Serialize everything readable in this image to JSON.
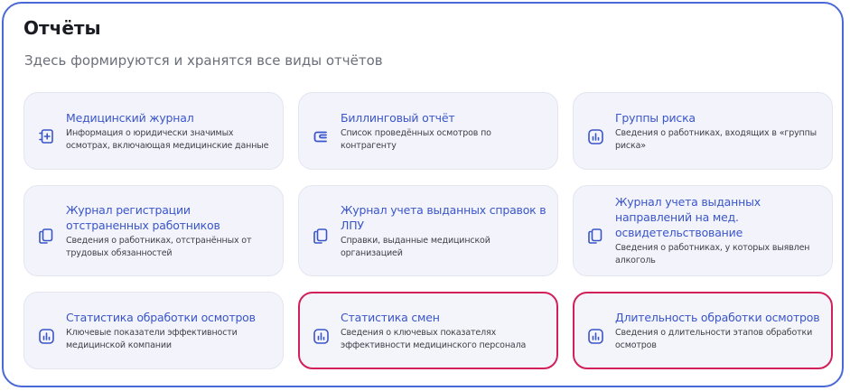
{
  "page": {
    "title": "Отчёты",
    "subtitle": "Здесь формируются и хранятся все виды отчётов"
  },
  "colors": {
    "accent": "#3a55c9",
    "frame_border": "#4a68d6",
    "highlight_border": "#d1205a",
    "card_background": "#f3f4fb"
  },
  "reports": [
    {
      "title": "Медицинский журнал",
      "description": "Информация о юридически значимых осмотрах, включающая медицинские данные",
      "icon": "journal-plus-icon"
    },
    {
      "title": "Биллинговый отчёт",
      "description": "Список проведённых осмотров по контрагенту",
      "icon": "wallet-icon"
    },
    {
      "title": "Группы риска",
      "description": "Сведения о работниках, входящих в «группы риска»",
      "icon": "bar-chart-icon"
    },
    {
      "title": "Журнал регистрации отстраненных работников",
      "description": "Сведения о работниках, отстранённых от трудовых обязанностей",
      "icon": "documents-icon"
    },
    {
      "title": "Журнал учета выданных справок в ЛПУ",
      "description": "Справки, выданные медицинской организацией",
      "icon": "documents-icon"
    },
    {
      "title": "Журнал учета выданных направлений на мед. освидетельствование",
      "description": "Сведения о работниках, у которых выявлен алкоголь",
      "icon": "documents-icon"
    },
    {
      "title": "Статистика обработки осмотров",
      "description": "Ключевые показатели эффективности медицинской компании",
      "icon": "bar-chart-icon"
    },
    {
      "title": "Статистика смен",
      "description": "Сведения о ключевых показателях эффективности медицинского персонала",
      "icon": "bar-chart-icon"
    },
    {
      "title": "Длительность обработки осмотров",
      "description": "Сведения о длительности этапов обработки осмотров",
      "icon": "bar-chart-icon"
    }
  ]
}
